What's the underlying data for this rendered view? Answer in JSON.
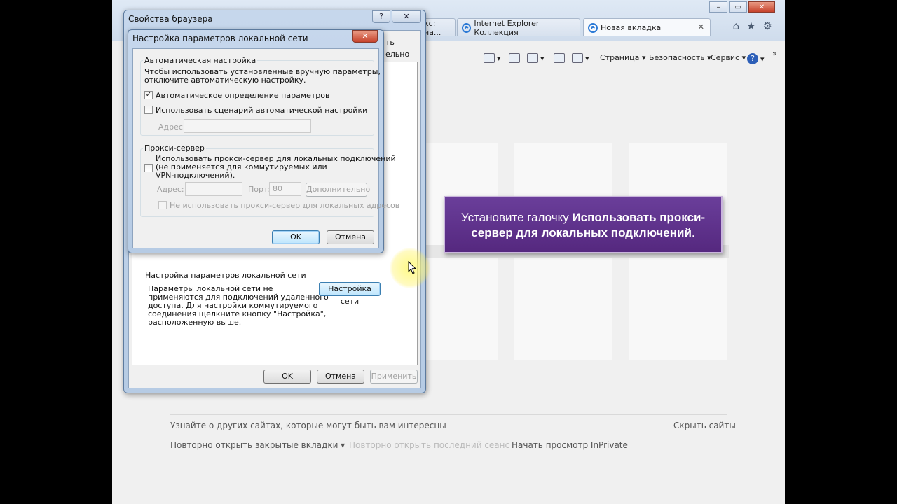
{
  "browser": {
    "window_controls": [
      "–",
      "▭",
      "✕"
    ],
    "tabs": [
      {
        "label": "кс: на...",
        "has_close": true
      },
      {
        "label": "Internet Explorer Коллекция"
      },
      {
        "label": "Новая вкладка",
        "active": true,
        "close": "✕"
      }
    ],
    "nav_icons": [
      "home-icon",
      "favorites-star-icon",
      "gear-icon"
    ],
    "command_bar": {
      "page_label": "Страница ▾",
      "safety_label": "Безопасность ▾",
      "tools_label": "Сервис ▾",
      "more": "»"
    }
  },
  "new_tab_page": {
    "discover_text": "Узнайте о других сайтах, которые могут быть вам интересны",
    "hide_sites": "Скрыть сайты",
    "reopen_tabs": "Повторно открыть закрытые вкладки ▾",
    "reopen_session": "Повторно открыть последний сеанс",
    "inprivate": "Начать просмотр InPrivate"
  },
  "callout": {
    "prefix": "Установите галочку ",
    "bold": "Использовать прокси-сервер для локальных подключений",
    "suffix": ".",
    "color": "#5e3189"
  },
  "internet_options": {
    "title": "Свойства браузера",
    "help_btn": "?",
    "close_btn": "✕",
    "tab_fragments": [
      "ть",
      "ельно"
    ],
    "lan_section_title": "Настройка параметров локальной сети",
    "lan_description": [
      "Параметры локальной сети не",
      "применяются для подключений удаленного",
      "доступа. Для настройки коммутируемого",
      "соединения щелкните кнопку \"Настройка\",",
      "расположенную выше."
    ],
    "lan_button": "Настройка сети",
    "ok": "OK",
    "cancel": "Отмена",
    "apply": "Применить"
  },
  "lan_settings": {
    "title": "Настройка параметров локальной сети",
    "close_btn": "✕",
    "auto_group": "Автоматическая настройка",
    "auto_desc": [
      "Чтобы использовать установленные вручную параметры,",
      "отключите автоматическую настройку."
    ],
    "auto_detect": {
      "label": "Автоматическое определение параметров",
      "checked": true
    },
    "auto_script": {
      "label": "Использовать сценарий автоматической настройки",
      "checked": false
    },
    "address_label": "Адрес",
    "proxy_group": "Прокси-сервер",
    "use_proxy": {
      "label_lines": [
        "Использовать прокси-сервер для локальных подключений",
        "(не применяется для коммутируемых или",
        "VPN-подключений)."
      ],
      "checked": false
    },
    "proxy_address_label": "Адрес:",
    "port_label": "Порт:",
    "port_value": "80",
    "advanced": "Дополнительно",
    "bypass_local": {
      "label": "Не использовать прокси-сервер для локальных адресов",
      "checked": false
    },
    "ok": "OK",
    "cancel": "Отмена"
  }
}
